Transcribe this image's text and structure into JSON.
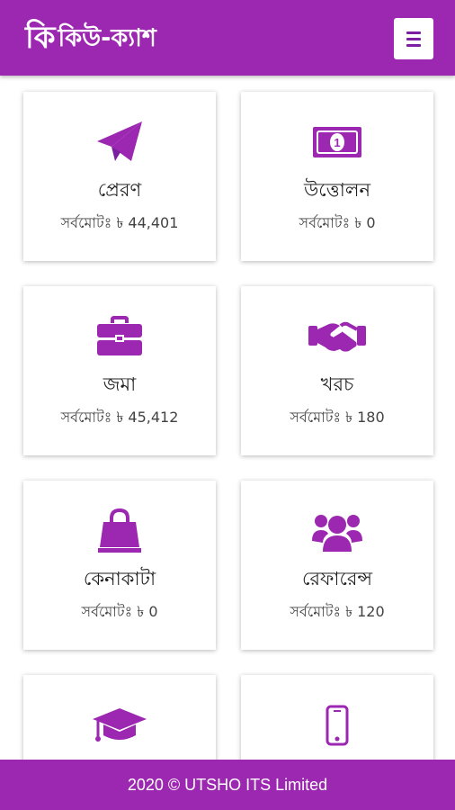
{
  "header": {
    "logo_mark": "কি",
    "logo_text": "কিউ-ক্যাশ"
  },
  "menu": {
    "icon": "hamburger-menu-icon"
  },
  "cards": [
    {
      "title": "প্রেরণ",
      "total": "সর্বমোটঃ ৳ 44,401",
      "icon": "paper-plane-icon"
    },
    {
      "title": "উত্তোলন",
      "total": "সর্বমোটঃ ৳ 0",
      "icon": "money-bill-icon"
    },
    {
      "title": "জমা",
      "total": "সর্বমোটঃ ৳ 45,412",
      "icon": "briefcase-icon"
    },
    {
      "title": "খরচ",
      "total": "সর্বমোটঃ ৳ 180",
      "icon": "handshake-icon"
    },
    {
      "title": "কেনাকাটা",
      "total": "সর্বমোটঃ ৳ 0",
      "icon": "shopping-bag-icon"
    },
    {
      "title": "রেফারেন্স",
      "total": "সর্বমোটঃ ৳ 120",
      "icon": "users-icon"
    },
    {
      "icon": "graduation-cap-icon"
    },
    {
      "icon": "mobile-phone-icon"
    }
  ],
  "footer": {
    "text": "2020 © UTSHO ITS Limited"
  },
  "colors": {
    "primary": "#9c27b0",
    "icon": "#9c27b0",
    "background": "#ffffff"
  }
}
